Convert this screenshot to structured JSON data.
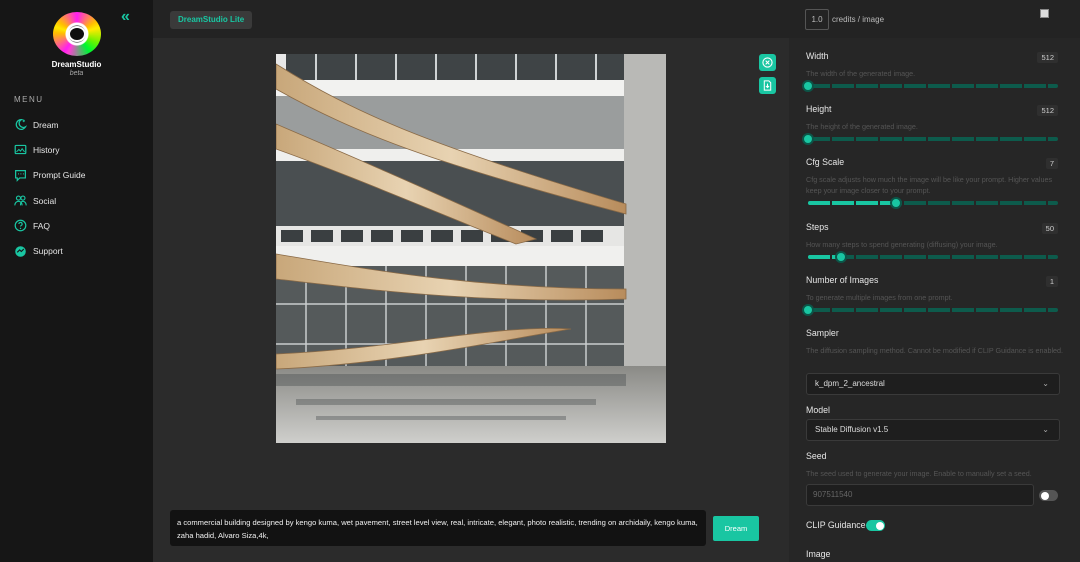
{
  "app": {
    "brand": "DreamStudio",
    "brand_sub": "beta",
    "badge": "DreamStudio Lite"
  },
  "sidebar": {
    "menu_title": "MENU",
    "items": [
      {
        "label": "Dream",
        "icon": "dream-icon"
      },
      {
        "label": "History",
        "icon": "history-icon"
      },
      {
        "label": "Prompt Guide",
        "icon": "prompt-guide-icon"
      },
      {
        "label": "Social",
        "icon": "social-icon"
      },
      {
        "label": "FAQ",
        "icon": "faq-icon"
      },
      {
        "label": "Support",
        "icon": "support-icon"
      }
    ]
  },
  "topbar": {
    "credits_value": "1.0",
    "credits_label": "credits / image"
  },
  "main": {
    "prompt": "a commercial building designed by kengo kuma, wet pavement, street level view, real, intricate, elegant, photo realistic, trending on archidaily, kengo kuma, zaha hadid, Alvaro Siza,4k,",
    "dream_button": "Dream",
    "image_actions": [
      "close-icon",
      "download-icon"
    ]
  },
  "settings": {
    "width": {
      "label": "Width",
      "desc": "The width of the generated image.",
      "value": "512",
      "fraction": 0.0
    },
    "height": {
      "label": "Height",
      "desc": "The height of the generated image.",
      "value": "512",
      "fraction": 0.0
    },
    "cfg": {
      "label": "Cfg Scale",
      "desc": "Cfg scale adjusts how much the image will be like your prompt. Higher values keep your image closer to your prompt.",
      "value": "7",
      "fraction": 0.35
    },
    "steps": {
      "label": "Steps",
      "desc": "How many steps to spend generating (diffusing) your image.",
      "value": "50",
      "fraction": 0.13
    },
    "num_images": {
      "label": "Number of Images",
      "desc": "To generate multiple images from one prompt.",
      "value": "1",
      "fraction": 0.0
    },
    "sampler": {
      "label": "Sampler",
      "desc": "The diffusion sampling method. Cannot be modified if CLIP Guidance is enabled.",
      "value": "k_dpm_2_ancestral"
    },
    "model": {
      "label": "Model",
      "value": "Stable Diffusion v1.5"
    },
    "seed": {
      "label": "Seed",
      "desc": "The seed used to generate your image. Enable to manually set a seed.",
      "value": "907511540",
      "enabled": false
    },
    "clip": {
      "label": "CLIP Guidance",
      "enabled": true
    },
    "image_label": "Image"
  },
  "colors": {
    "accent": "#19c6a2",
    "sidebar_bg": "#161616",
    "panel_bg": "#262626"
  }
}
